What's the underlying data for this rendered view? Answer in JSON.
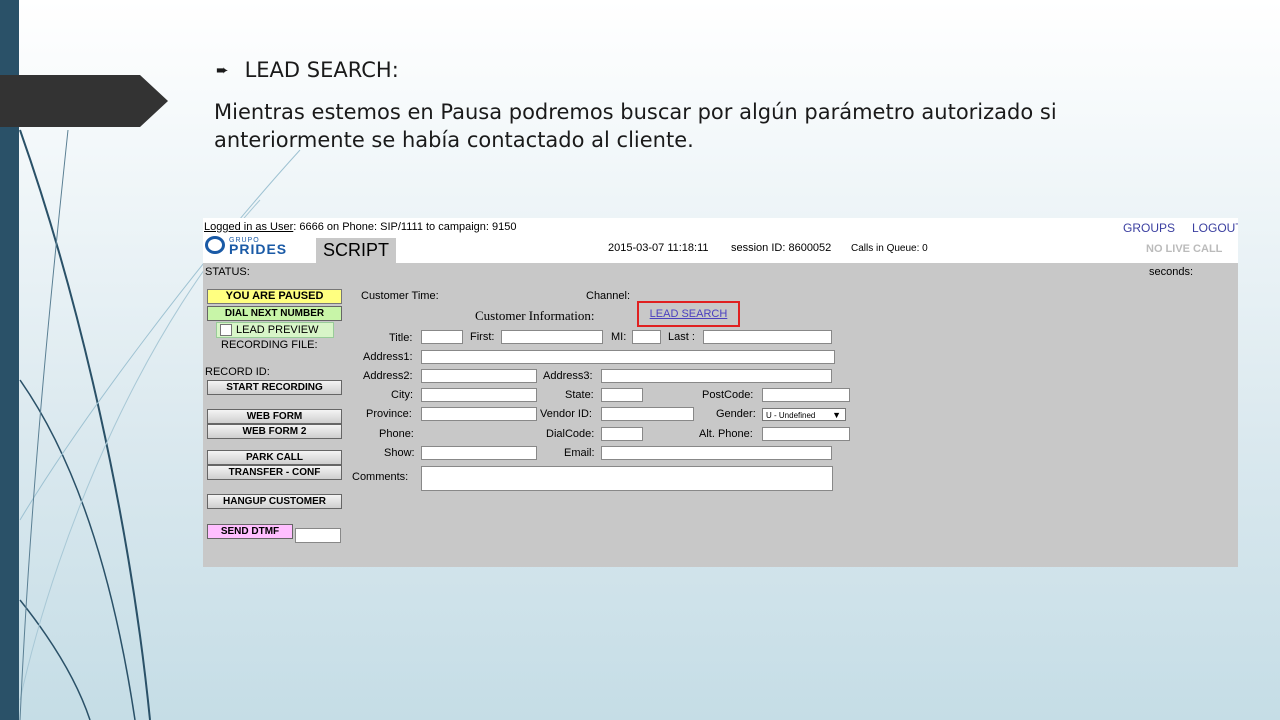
{
  "slide": {
    "heading": "LEAD SEARCH:",
    "body": "Mientras estemos en Pausa podremos buscar por algún parámetro autorizado si anteriormente se había contactado al cliente."
  },
  "agent": {
    "logged_in_label": "Logged in as User",
    "login_info": ": 6666 on Phone: SIP/1111  to campaign: 9150",
    "groups_link": "GROUPS",
    "logout_link": "LOGOUT",
    "logo_small": "GRUPO",
    "logo_big": "PRIDES",
    "script_tab": "SCRIPT",
    "datetime": "2015-03-07 11:18:11",
    "session": "session ID: 8600052",
    "calls_queue": "Calls in Queue: 0",
    "no_live_call": "NO LIVE CALL",
    "status_label": "STATUS:",
    "seconds_label": "seconds:",
    "buttons": {
      "paused": "YOU ARE PAUSED",
      "dial_next": "DIAL NEXT NUMBER",
      "lead_preview": "LEAD PREVIEW",
      "recording_file": "RECORDING FILE:",
      "record_id": "RECORD ID:",
      "start_recording": "START RECORDING",
      "web_form": "WEB FORM",
      "web_form_2": "WEB FORM 2",
      "park_call": "PARK CALL",
      "transfer_conf": "TRANSFER - CONF",
      "hangup": "HANGUP CUSTOMER",
      "send_dtmf": "SEND DTMF"
    },
    "form": {
      "customer_time": "Customer Time:",
      "channel": "Channel:",
      "customer_info": "Customer Information:",
      "lead_search": "LEAD SEARCH",
      "title": "Title:",
      "first": "First:",
      "mi": "MI:",
      "last": "Last :",
      "address1": "Address1:",
      "address2": "Address2:",
      "address3": "Address3:",
      "city": "City:",
      "state": "State:",
      "postcode": "PostCode:",
      "province": "Province:",
      "vendor_id": "Vendor ID:",
      "gender": "Gender:",
      "gender_value": "U - Undefined",
      "phone": "Phone:",
      "dialcode": "DialCode:",
      "alt_phone": "Alt. Phone:",
      "show": "Show:",
      "email": "Email:",
      "comments": "Comments:"
    }
  },
  "colors": {
    "sidebar": "#2a5168",
    "highlight": "#e02020",
    "link": "#4a3fbf",
    "paused": "#ffff80"
  }
}
